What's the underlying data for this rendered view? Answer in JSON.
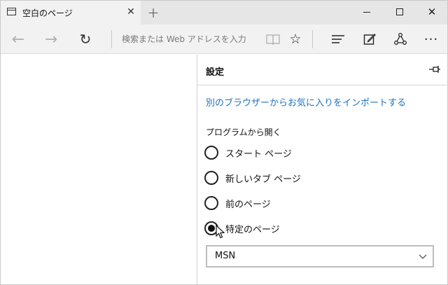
{
  "tab": {
    "title": "空白のページ",
    "close_glyph": "✕",
    "new_tab_glyph": "+"
  },
  "window_controls": {
    "minimize": "",
    "maximize": "",
    "close_glyph": "✕"
  },
  "toolbar": {
    "back_glyph": "←",
    "forward_glyph": "→",
    "refresh_glyph": "↻",
    "address_placeholder": "検索または Web アドレスを入力",
    "reading_glyph": "📖",
    "favorite_glyph": "☆",
    "more_glyph": "···"
  },
  "settings": {
    "title": "設定",
    "import_link": "別のブラウザーからお気に入りをインポートする",
    "open_with_label": "プログラムから開く",
    "options": [
      {
        "label": "スタート ページ",
        "checked": false
      },
      {
        "label": "新しいタブ ページ",
        "checked": false
      },
      {
        "label": "前のページ",
        "checked": false
      },
      {
        "label": "特定のページ",
        "checked": true
      }
    ],
    "page_select": {
      "value": "MSN"
    }
  },
  "colors": {
    "link": "#1e73be",
    "toolbar_bg": "#f2f2f2",
    "titlebar_bg": "#e6e6e6"
  }
}
